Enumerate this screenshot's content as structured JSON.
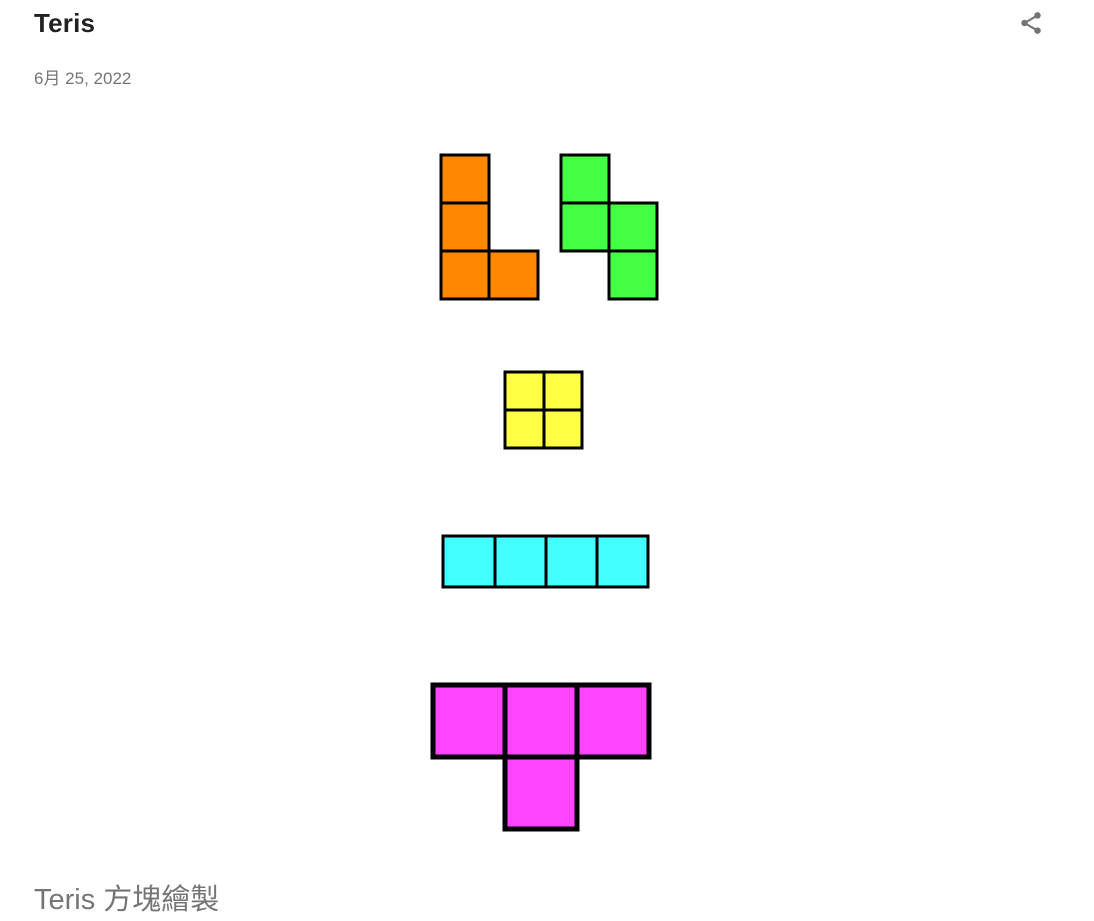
{
  "post": {
    "title": "Teris",
    "date": "6月 25, 2022",
    "caption": "Teris 方塊繪製"
  },
  "header": {
    "share_icon": "share-icon"
  },
  "pieces": [
    {
      "name": "l-piece",
      "color": "#FF8800"
    },
    {
      "name": "s-piece",
      "color": "#44FF44"
    },
    {
      "name": "o-piece",
      "color": "#FFFF44"
    },
    {
      "name": "i-piece",
      "color": "#44FFFF"
    },
    {
      "name": "t-piece",
      "color": "#FF44FF"
    }
  ]
}
